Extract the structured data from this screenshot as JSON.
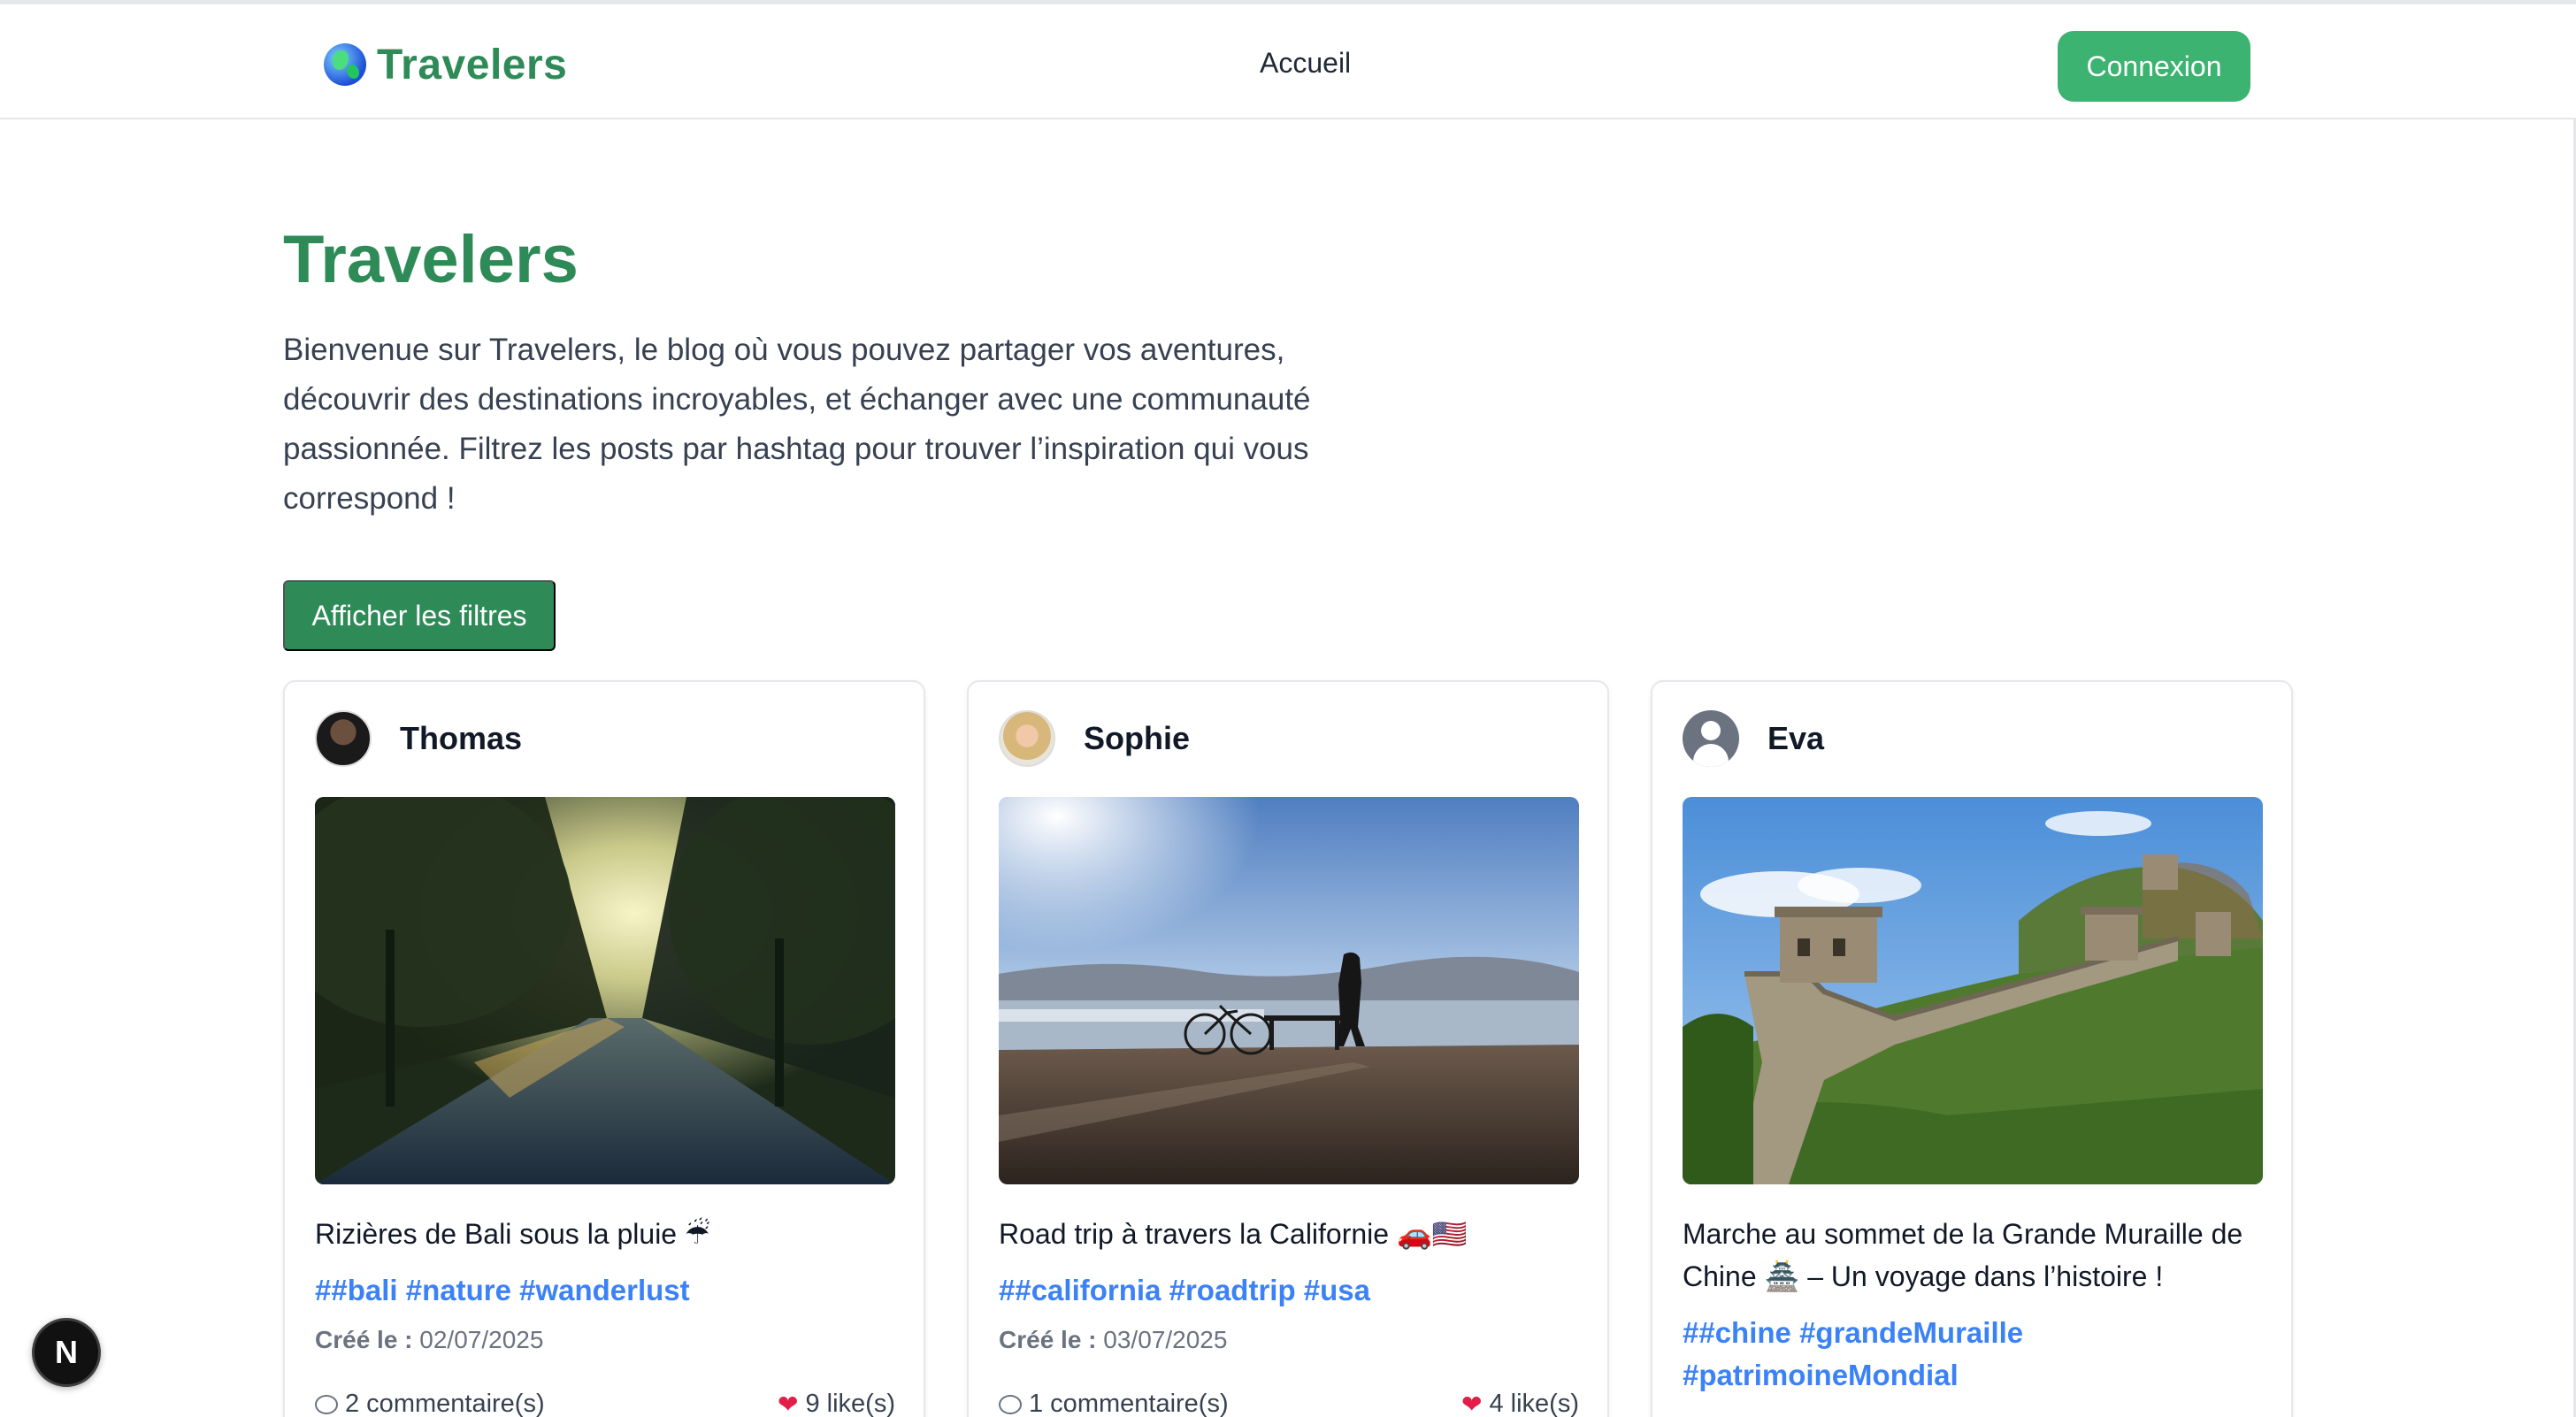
{
  "navbar": {
    "brand": "Travelers",
    "brand_icon": "globe-icon",
    "links": [
      "Accueil"
    ],
    "login_label": "Connexion"
  },
  "hero": {
    "title": "Travelers",
    "description": "Bienvenue sur Travelers, le blog où vous pouvez partager vos aventures, découvrir des destinations incroyables, et échanger avec une communauté passionnée. Filtrez les posts par hashtag pour trouver l’inspiration qui vous correspond !",
    "filter_button": "Afficher les filtres"
  },
  "posts": [
    {
      "author": "Thomas",
      "avatar": "avatar-photo",
      "image": "sunlit-tree-lined-road",
      "caption": "Rizières de Bali sous la pluie ☔",
      "hashtags": "##bali #nature #wanderlust",
      "created_label": "Créé le :",
      "created_date": "02/07/2025",
      "comments": "2 commentaire(s)",
      "likes": "9 like(s)"
    },
    {
      "author": "Sophie",
      "avatar": "avatar-photo",
      "image": "person-with-bicycle-by-the-sea",
      "caption": "Road trip à travers la Californie 🚗🇺🇸",
      "hashtags": "##california #roadtrip #usa",
      "created_label": "Créé le :",
      "created_date": "03/07/2025",
      "comments": "1 commentaire(s)",
      "likes": "4 like(s)"
    },
    {
      "author": "Eva",
      "avatar": "default-user-icon",
      "image": "great-wall-of-china",
      "caption": "Marche au sommet de la Grande Muraille de Chine 🏯 – Un voyage dans l’histoire !",
      "hashtags": "##chine #grandeMuraille #patrimoineMondial"
    }
  ],
  "floating_badge": "N",
  "colors": {
    "brand_green": "#2e8b57",
    "login_green": "#3cb371",
    "hashtag_blue": "#3b82f6"
  }
}
